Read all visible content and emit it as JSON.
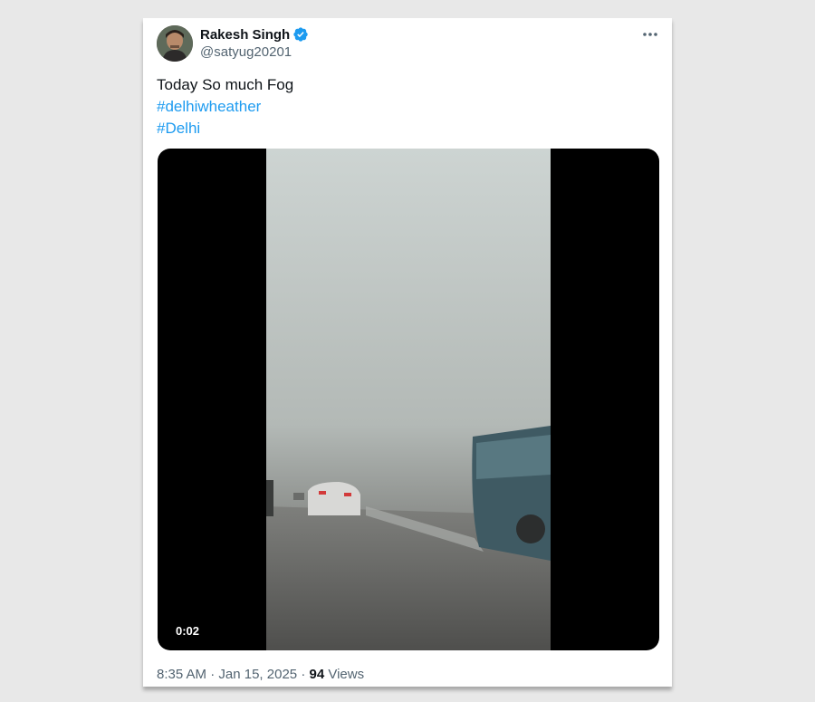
{
  "tweet": {
    "author_name": "Rakesh Singh",
    "handle": "@satyug20201",
    "text_line": "Today So much Fog",
    "hashtags": [
      "#delhiwheather",
      "#Delhi"
    ],
    "video": {
      "duration": "0:02"
    },
    "time": "8:35 AM",
    "separator": "·",
    "date": "Jan 15, 2025",
    "separator2": "·",
    "views_count": "94",
    "views_label": "Views"
  },
  "colors": {
    "accent": "#1d9bf0",
    "text": "#0f1419",
    "secondary": "#536471",
    "background": "#e8e8e8"
  },
  "icons": {
    "verified": "verified-badge-icon",
    "more": "more-options-icon"
  }
}
